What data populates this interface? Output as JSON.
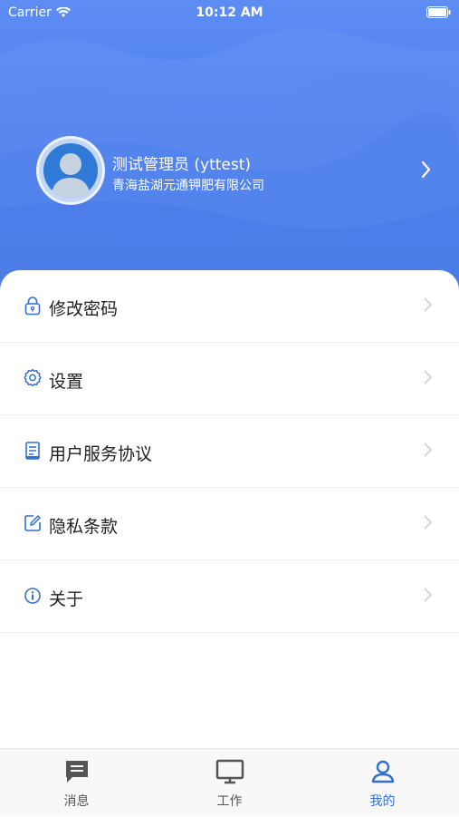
{
  "status_bar": {
    "carrier": "Carrier",
    "time": "10:12 AM"
  },
  "profile": {
    "name": "测试管理员 (yttest)",
    "company": "青海盐湖元通钾肥有限公司"
  },
  "menu": {
    "items": [
      {
        "label": "修改密码",
        "icon": "lock-icon"
      },
      {
        "label": "设置",
        "icon": "gear-icon"
      },
      {
        "label": "用户服务协议",
        "icon": "document-icon"
      },
      {
        "label": "隐私条款",
        "icon": "edit-icon"
      },
      {
        "label": "关于",
        "icon": "info-icon"
      }
    ]
  },
  "tabbar": {
    "tabs": [
      {
        "label": "消息",
        "icon": "message-icon",
        "active": false
      },
      {
        "label": "工作",
        "icon": "monitor-icon",
        "active": false
      },
      {
        "label": "我的",
        "icon": "user-icon",
        "active": true
      }
    ]
  },
  "colors": {
    "accent": "#2f6fd6",
    "header": "#4e80ef"
  }
}
